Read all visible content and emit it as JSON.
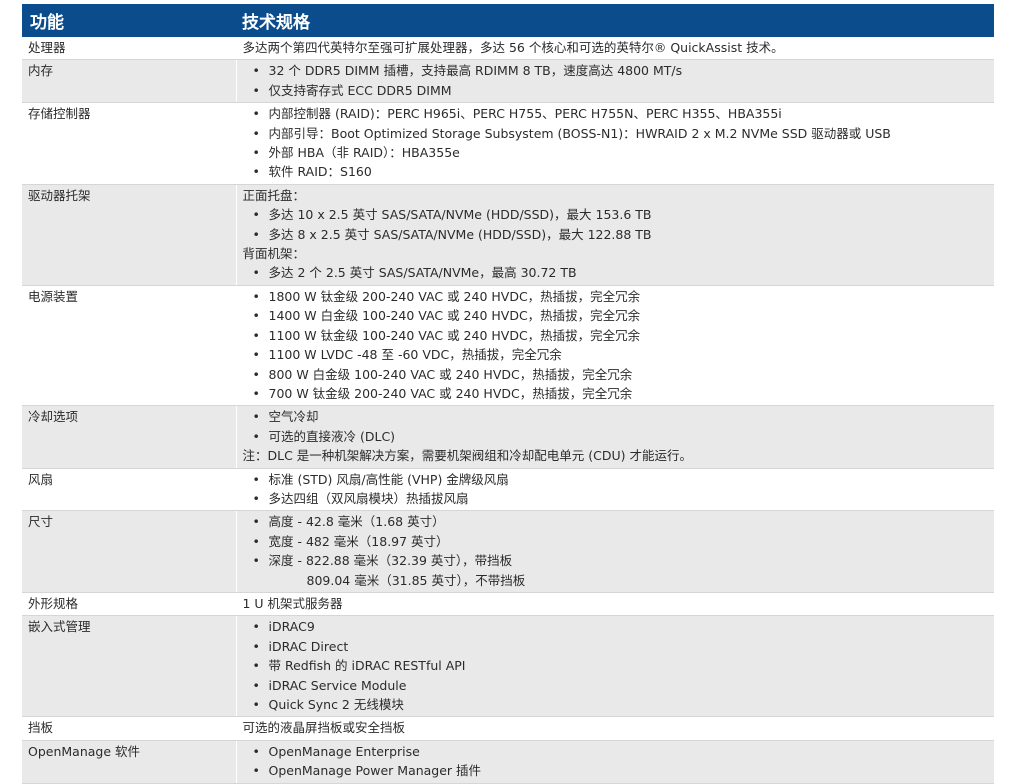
{
  "header": {
    "col1": "功能",
    "col2": "技术规格"
  },
  "rows": [
    {
      "label": "处理器",
      "text": "多达两个第四代英特尔至强可扩展处理器，多达 56 个核心和可选的英特尔® QuickAssist 技术。"
    },
    {
      "label": "内存",
      "items": [
        "32 个 DDR5 DIMM 插槽，支持最高 RDIMM 8 TB，速度高达 4800 MT/s",
        "仅支持寄存式 ECC DDR5 DIMM"
      ]
    },
    {
      "label": "存储控制器",
      "items": [
        "内部控制器 (RAID)：PERC H965i、PERC H755、PERC H755N、PERC H355、HBA355i",
        "内部引导：Boot Optimized Storage Subsystem (BOSS-N1)：HWRAID 2 x M.2 NVMe SSD 驱动器或 USB",
        "外部 HBA（非 RAID）：HBA355e",
        "软件 RAID：S160"
      ]
    },
    {
      "label": "驱动器托架",
      "front_heading": "正面托盘：",
      "front_items": [
        "多达 10 x 2.5 英寸 SAS/SATA/NVMe (HDD/SSD)，最大 153.6 TB",
        "多达 8 x 2.5 英寸 SAS/SATA/NVMe (HDD/SSD)，最大 122.88 TB"
      ],
      "rear_heading": "背面机架：",
      "rear_items": [
        "多达 2 个 2.5 英寸 SAS/SATA/NVMe，最高 30.72 TB"
      ]
    },
    {
      "label": "电源装置",
      "items": [
        "1800 W 钛金级 200-240 VAC 或 240 HVDC，热插拔，完全冗余",
        "1400 W 白金级 100-240 VAC 或 240 HVDC，热插拔，完全冗余",
        "1100 W 钛金级 100-240 VAC 或 240 HVDC，热插拔，完全冗余",
        "1100 W LVDC -48 至 -60 VDC，热插拔，完全冗余",
        "800 W 白金级 100-240 VAC 或 240 HVDC，热插拔，完全冗余",
        "700 W 钛金级 200-240 VAC 或 240 HVDC，热插拔，完全冗余"
      ]
    },
    {
      "label": "冷却选项",
      "items": [
        "空气冷却",
        "可选的直接液冷 (DLC)"
      ],
      "note": "注：DLC 是一种机架解决方案，需要机架阀组和冷却配电单元 (CDU) 才能运行。"
    },
    {
      "label": "风扇",
      "items": [
        "标准 (STD) 风扇/高性能 (VHP) 金牌级风扇",
        "多达四组（双风扇模块）热插拔风扇"
      ]
    },
    {
      "label": "尺寸",
      "items": [
        "高度 - 42.8 毫米（1.68 英寸）",
        "宽度 - 482 毫米（18.97 英寸）",
        "深度 - 822.88 毫米（32.39 英寸），带挡板"
      ],
      "cont": "809.04 毫米（31.85 英寸），不带挡板"
    },
    {
      "label": "外形规格",
      "text": "1 U 机架式服务器"
    },
    {
      "label": "嵌入式管理",
      "items": [
        "iDRAC9",
        "iDRAC Direct",
        "带 Redfish 的 iDRAC RESTful API",
        "iDRAC Service Module",
        "Quick Sync 2 无线模块"
      ]
    },
    {
      "label": "挡板",
      "text": "可选的液晶屏挡板或安全挡板"
    },
    {
      "label": "OpenManage 软件",
      "items": [
        "OpenManage Enterprise",
        "OpenManage Power Manager 插件"
      ]
    }
  ]
}
